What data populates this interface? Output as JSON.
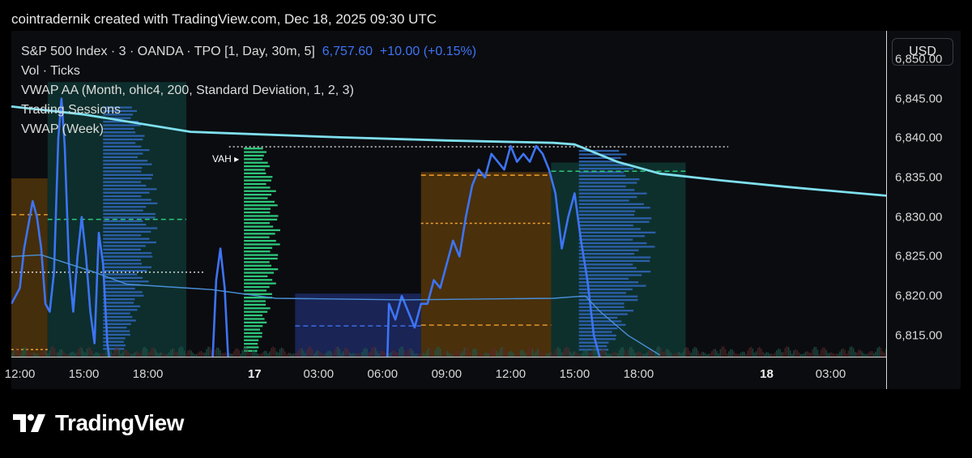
{
  "header": {
    "text": "cointradernik created with TradingView.com, Dec 18, 2025 09:30 UTC"
  },
  "legend": {
    "symbol": "S&P 500 Index · 3 · OANDA · TPO [1, Day, 30m, 5]",
    "price": "6,757.60",
    "change": "+10.00 (+0.15%)",
    "line2": "Vol · Ticks",
    "line3": "VWAP AA (Month, ohlc4, 200, Standard Deviation, 1, 2, 3)",
    "line4": "Trading Sessions",
    "line5": "VWAP (Week)"
  },
  "axis": {
    "currency": "USD"
  },
  "vah_label": "VAH",
  "brand": {
    "name": "TradingView"
  },
  "colors": {
    "price_line": "#3d74f5",
    "vwap_week": "#7fdfee",
    "vwap_aa": "#4a8fd8",
    "session_asia": "#1e2a66",
    "session_london": "#5a3a0a",
    "session_ny": "#0f3a35",
    "tpo_profile": "#2c5fa8",
    "tpo_green": "#2ec77a",
    "poc": "#f0a030"
  },
  "chart_data": {
    "type": "line",
    "y_ticks": [
      "6,850.00",
      "6,845.00",
      "6,840.00",
      "6,835.00",
      "6,830.00",
      "6,825.00",
      "6,820.00",
      "6,815.00"
    ],
    "y_tick_values": [
      6850,
      6845,
      6840,
      6835,
      6830,
      6825,
      6820,
      6815
    ],
    "ylim": [
      6812.3,
      6853.6
    ],
    "x_ticks": [
      {
        "label": "12:00",
        "h": 0
      },
      {
        "label": "15:00",
        "h": 3
      },
      {
        "label": "18:00",
        "h": 6
      },
      {
        "label": "17",
        "h": 11,
        "bold": true
      },
      {
        "label": "03:00",
        "h": 14
      },
      {
        "label": "06:00",
        "h": 17
      },
      {
        "label": "09:00",
        "h": 20
      },
      {
        "label": "12:00",
        "h": 23
      },
      {
        "label": "15:00",
        "h": 26
      },
      {
        "label": "18:00",
        "h": 29
      },
      {
        "label": "18",
        "h": 35,
        "bold": true
      },
      {
        "label": "03:00",
        "h": 38
      }
    ],
    "xlim_hours": [
      -0.4,
      40.6
    ],
    "series": [
      {
        "key": "price",
        "points": [
          [
            -0.4,
            6819
          ],
          [
            -0.2,
            6820
          ],
          [
            0,
            6821
          ],
          [
            0.2,
            6826
          ],
          [
            0.4,
            6829
          ],
          [
            0.6,
            6832
          ],
          [
            0.8,
            6830
          ],
          [
            1,
            6826
          ],
          [
            1.2,
            6819
          ],
          [
            1.4,
            6818
          ],
          [
            1.6,
            6823
          ],
          [
            1.8,
            6840
          ],
          [
            1.95,
            6845
          ],
          [
            2.1,
            6839
          ],
          [
            2.3,
            6824
          ],
          [
            2.5,
            6818
          ],
          [
            2.7,
            6825
          ],
          [
            2.9,
            6830
          ],
          [
            3.1,
            6825
          ],
          [
            3.3,
            6818
          ],
          [
            3.5,
            6814
          ],
          [
            3.7,
            6828
          ],
          [
            3.9,
            6824
          ],
          [
            4.1,
            6814
          ],
          [
            4.3,
            6810
          ],
          [
            9,
            6810
          ],
          [
            9.2,
            6822
          ],
          [
            9.4,
            6826
          ],
          [
            9.6,
            6821
          ],
          [
            9.8,
            6810
          ],
          [
            14,
            6810
          ],
          [
            17.2,
            6810
          ],
          [
            17.3,
            6819
          ],
          [
            17.6,
            6817
          ],
          [
            17.9,
            6820
          ],
          [
            18.2,
            6818
          ],
          [
            18.5,
            6816
          ],
          [
            18.8,
            6819
          ],
          [
            19.1,
            6819
          ],
          [
            19.4,
            6822
          ],
          [
            19.7,
            6821
          ],
          [
            20,
            6824
          ],
          [
            20.3,
            6827
          ],
          [
            20.6,
            6825
          ],
          [
            20.9,
            6830
          ],
          [
            21.2,
            6834
          ],
          [
            21.5,
            6836
          ],
          [
            21.8,
            6835
          ],
          [
            22.1,
            6838
          ],
          [
            22.4,
            6837
          ],
          [
            22.7,
            6836
          ],
          [
            23,
            6839
          ],
          [
            23.3,
            6837
          ],
          [
            23.6,
            6838
          ],
          [
            23.9,
            6837
          ],
          [
            24.2,
            6839
          ],
          [
            24.5,
            6838
          ],
          [
            24.8,
            6836
          ],
          [
            25.1,
            6833
          ],
          [
            25.4,
            6826
          ],
          [
            25.7,
            6830
          ],
          [
            26,
            6833
          ],
          [
            26.3,
            6827
          ],
          [
            26.6,
            6822
          ],
          [
            26.9,
            6815
          ],
          [
            27.2,
            6812
          ],
          [
            27.5,
            6810
          ]
        ]
      },
      {
        "key": "vwap_week",
        "points": [
          [
            -0.4,
            6844
          ],
          [
            3,
            6843
          ],
          [
            8,
            6840.8
          ],
          [
            15,
            6840.1
          ],
          [
            20,
            6839.7
          ],
          [
            25,
            6839.4
          ],
          [
            26,
            6839.2
          ],
          [
            28,
            6837
          ],
          [
            30,
            6835.5
          ],
          [
            33,
            6834.6
          ],
          [
            36,
            6833.8
          ],
          [
            40.6,
            6832.7
          ]
        ]
      },
      {
        "key": "vwap_aa",
        "points": [
          [
            -0.4,
            6825
          ],
          [
            1,
            6825.2
          ],
          [
            3.5,
            6823
          ],
          [
            5,
            6821.5
          ],
          [
            9,
            6820.8
          ],
          [
            12,
            6819.7
          ],
          [
            18,
            6819.5
          ],
          [
            25,
            6819.7
          ],
          [
            26.5,
            6820
          ],
          [
            27.2,
            6818
          ],
          [
            28.5,
            6815
          ],
          [
            30,
            6812.5
          ]
        ]
      }
    ]
  }
}
